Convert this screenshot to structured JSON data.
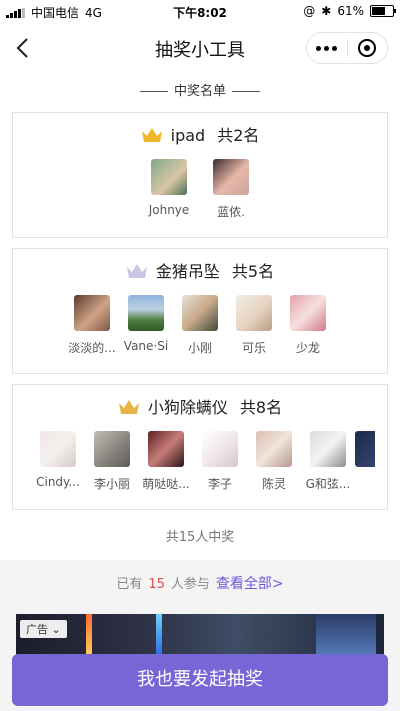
{
  "status_bar": {
    "carrier": "中国电信",
    "network": "4G",
    "time": "下午8:02",
    "battery": "61%"
  },
  "nav": {
    "title": "抽奖小工具"
  },
  "section_title": "中奖名单",
  "prizes": [
    {
      "name": "ipad",
      "count": "共2名",
      "winners": [
        {
          "name": "Johnye"
        },
        {
          "name": "蓝侬."
        }
      ]
    },
    {
      "name": "金猪吊坠",
      "count": "共5名",
      "winners": [
        {
          "name": "淡淡的..."
        },
        {
          "name": "Vane·Si"
        },
        {
          "name": "小刚"
        },
        {
          "name": "可乐"
        },
        {
          "name": "少龙"
        }
      ]
    },
    {
      "name": "小狗除螨仪",
      "count": "共8名",
      "winners": [
        {
          "name": "Cindy..."
        },
        {
          "name": "李小丽"
        },
        {
          "name": "萌哒哒..."
        },
        {
          "name": "李子"
        },
        {
          "name": "陈灵"
        },
        {
          "name": "G和弦..."
        }
      ]
    }
  ],
  "total_winners": "共15人中奖",
  "participation": {
    "prefix": "已有",
    "count": "15",
    "suffix": "人参与",
    "view_all": "查看全部>"
  },
  "ad": {
    "tag": "广告"
  },
  "cta": {
    "label": "我也要发起抽奖"
  },
  "colors": {
    "accent": "#7766d6",
    "count_red": "#e24b4b",
    "link": "#6a5bdc",
    "gold": "#f0b92c",
    "silver": "#c9c6e6"
  }
}
